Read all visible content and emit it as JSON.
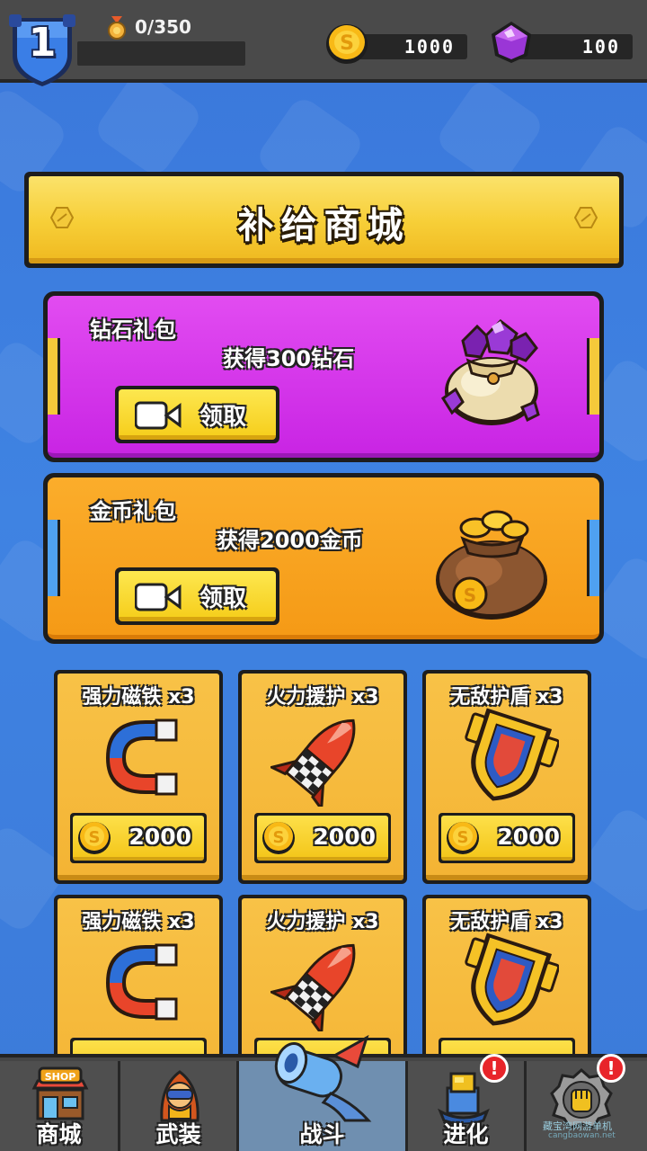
{
  "topbar": {
    "level": "1",
    "xp_text": "0/350",
    "gold_amount": "1000",
    "gem_amount": "100"
  },
  "title": "补给商城",
  "gifts": [
    {
      "title": "钻石礼包",
      "desc": "获得300钻石",
      "button": "领取",
      "theme": "diamond"
    },
    {
      "title": "金币礼包",
      "desc": "获得2000金币",
      "button": "领取",
      "theme": "gold"
    }
  ],
  "items": [
    {
      "name": "强力磁铁 x3",
      "price": "2000",
      "icon": "magnet-icon"
    },
    {
      "name": "火力援护 x3",
      "price": "2000",
      "icon": "rocket-icon"
    },
    {
      "name": "无敌护盾 x3",
      "price": "2000",
      "icon": "shield-icon"
    },
    {
      "name": "强力磁铁 x3",
      "price": "",
      "icon": "magnet-icon"
    },
    {
      "name": "火力援护 x3",
      "price": "",
      "icon": "rocket-icon"
    },
    {
      "name": "无敌护盾 x3",
      "price": "",
      "icon": "shield-icon"
    }
  ],
  "nav": [
    {
      "label": "商城",
      "icon": "shop-icon",
      "badge_text": "SHOP"
    },
    {
      "label": "武装",
      "icon": "hero-icon"
    },
    {
      "label": "战斗",
      "icon": "battle-icon"
    },
    {
      "label": "进化",
      "icon": "evolve-icon",
      "alert": "!"
    },
    {
      "label": "",
      "icon": "fist-medal-icon",
      "alert": "!"
    }
  ],
  "watermark": {
    "line1": "藏宝湾网游单机",
    "line2": "cangbaowan.net"
  },
  "colors": {
    "diamond_panel": "#d23aeb",
    "gold_panel": "#f7a21f",
    "card": "#f6bb3d",
    "background": "#3f7fde",
    "title_banner": "#f7cf38"
  }
}
